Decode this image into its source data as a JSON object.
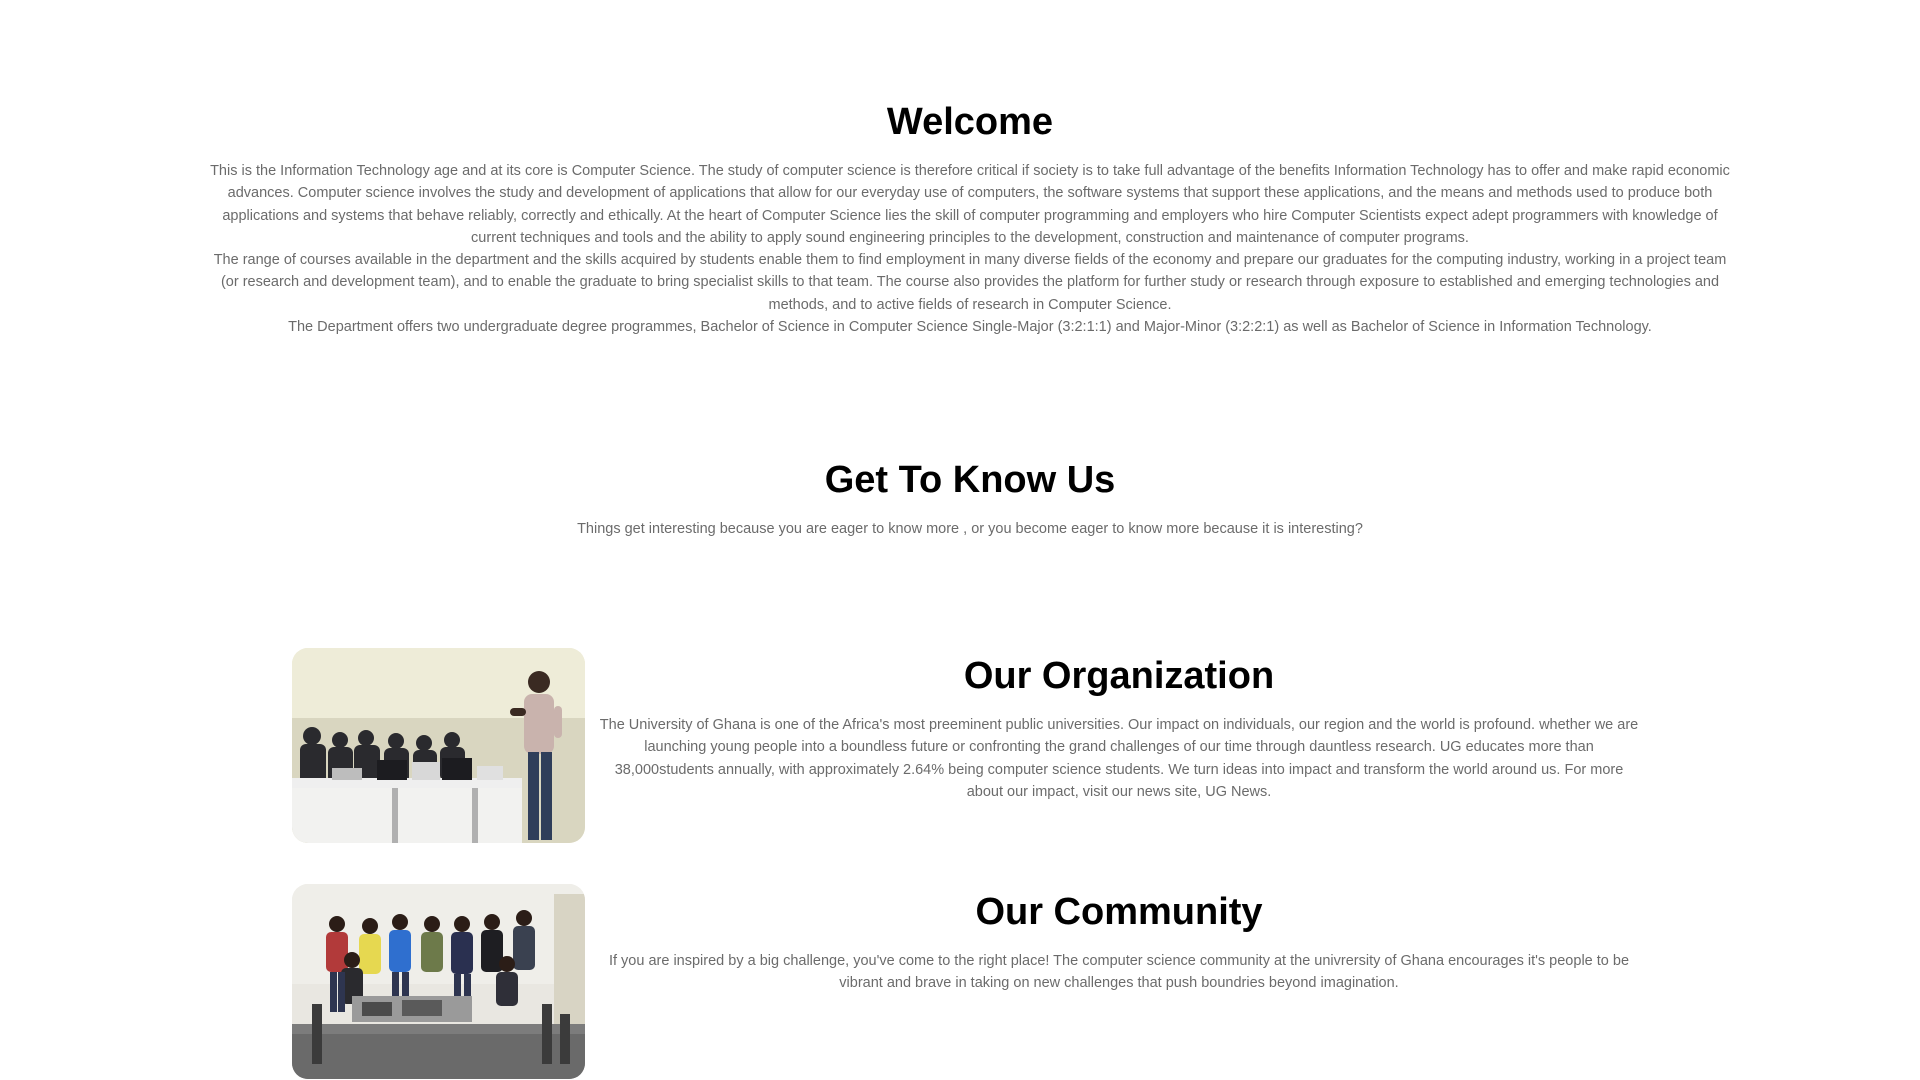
{
  "welcome": {
    "title": "Welcome",
    "paragraphs": [
      "This is the Information Technology age and at its core is Computer Science. The study of computer science is therefore critical if society is to take full advantage of the benefits Information Technology has to offer and make rapid economic advances. Computer science involves the study and development of applications that allow for our everyday use of computers, the software systems that support these applications, and the means and methods used to produce both applications and systems that behave reliably, correctly and ethically. At the heart of Computer Science lies the skill of computer programming and employers who hire Computer Scientists expect adept programmers with knowledge of current techniques and tools and the ability to apply sound engineering principles to the development, construction and maintenance of computer programs.",
      "The range of courses available in the department and the skills acquired by students enable them to find employment in many diverse fields of the economy and prepare our graduates for the computing industry, working in a project team (or research and development team), and to enable the graduate to bring specialist skills to that team. The course also provides the platform for further study or research through exposure to established and emerging technologies and methods, and to active fields of research in Computer Science.",
      "The Department offers two undergraduate degree programmes, Bachelor of Science in Computer Science Single-Major (3:2:1:1) and Major-Minor (3:2:2:1) as well as Bachelor of Science in Information Technology."
    ]
  },
  "know_us": {
    "title": "Get To Know Us",
    "subtitle": "Things get interesting because you are eager to know more , or you become eager to know more because it is interesting?"
  },
  "organization": {
    "title": "Our Organization",
    "text": "The University of Ghana is one of the Africa's most preeminent public universities. Our impact on individuals, our region and the world is profound. whether we are launching young people into a boundless future or confronting the grand challenges of our time through dauntless research. UG educates more than 38,000students annually, with approximately 2.64% being computer science students. We turn ideas into impact and transform the world around us. For more about our impact, visit our news site, UG News."
  },
  "community": {
    "title": "Our Community",
    "text": "If you are inspired by a big challenge, you've come to the right place! The computer science community at the univrersity of Ghana encourages it's people to be vibrant and brave in taking on new challenges that push boundries beyond imagination."
  },
  "colors": {
    "title_text": "#000000",
    "body_text": "#6b6b6b",
    "background": "#ffffff"
  }
}
